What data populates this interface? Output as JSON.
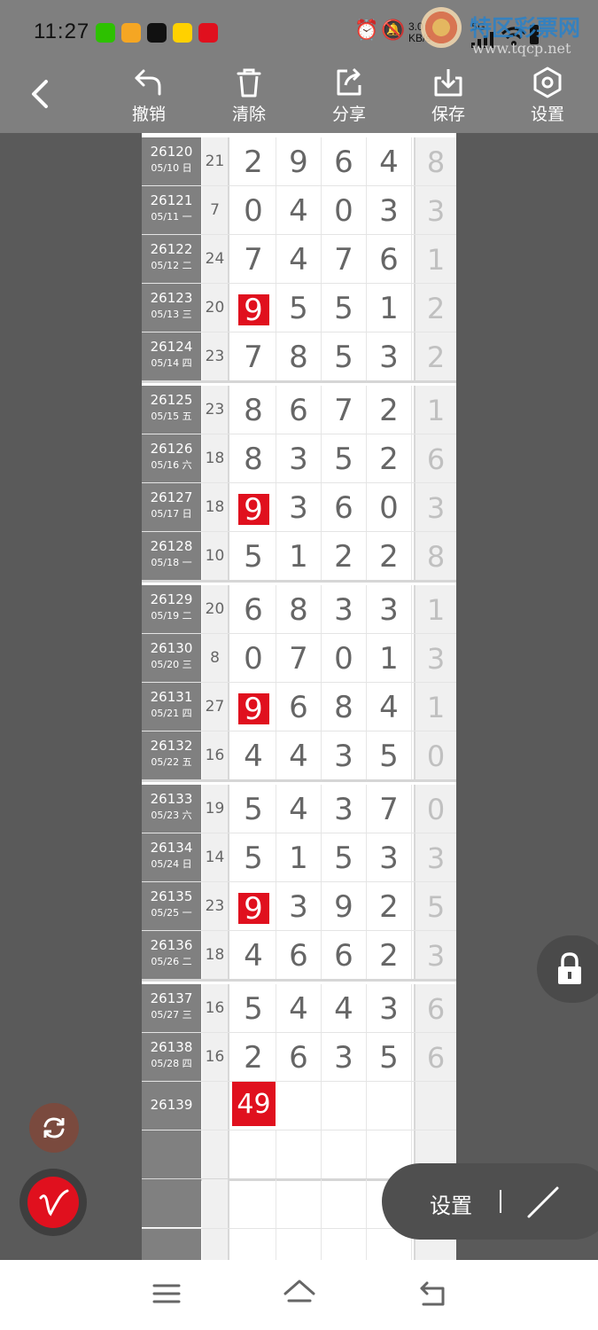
{
  "status_bar": {
    "time": "11:27",
    "app_icons": [
      {
        "icon": "wechat-icon",
        "color": "#2dc100"
      },
      {
        "icon": "app-icon",
        "color": "#f5a623"
      },
      {
        "icon": "tiktok-icon",
        "color": "#111111"
      },
      {
        "icon": "meituan-icon",
        "color": "#ffd100"
      },
      {
        "icon": "health-icon",
        "color": "#e0101e"
      }
    ],
    "net_speed_value": "3.0",
    "net_speed_unit": "KB/s",
    "signal_label": "5G",
    "watermark_title": "特区彩票网",
    "watermark_url": "www.tqcp.net"
  },
  "toolbar": {
    "undo": "撤销",
    "clear": "清除",
    "share": "分享",
    "save": "保存",
    "settings": "设置"
  },
  "rows": [
    {
      "issue": "26120",
      "date": "05/10 日",
      "sum": "21",
      "digits": [
        "2",
        "9",
        "6",
        "4"
      ],
      "extra": "8",
      "hit": -1
    },
    {
      "issue": "26121",
      "date": "05/11 一",
      "sum": "7",
      "digits": [
        "0",
        "4",
        "0",
        "3"
      ],
      "extra": "3",
      "hit": -1
    },
    {
      "issue": "26122",
      "date": "05/12 二",
      "sum": "24",
      "digits": [
        "7",
        "4",
        "7",
        "6"
      ],
      "extra": "1",
      "hit": -1
    },
    {
      "issue": "26123",
      "date": "05/13 三",
      "sum": "20",
      "digits": [
        "9",
        "5",
        "5",
        "1"
      ],
      "extra": "2",
      "hit": 0
    },
    {
      "issue": "26124",
      "date": "05/14 四",
      "sum": "23",
      "digits": [
        "7",
        "8",
        "5",
        "3"
      ],
      "extra": "2",
      "hit": -1
    },
    {
      "issue": "26125",
      "date": "05/15 五",
      "sum": "23",
      "digits": [
        "8",
        "6",
        "7",
        "2"
      ],
      "extra": "1",
      "hit": -1
    },
    {
      "issue": "26126",
      "date": "05/16 六",
      "sum": "18",
      "digits": [
        "8",
        "3",
        "5",
        "2"
      ],
      "extra": "6",
      "hit": -1
    },
    {
      "issue": "26127",
      "date": "05/17 日",
      "sum": "18",
      "digits": [
        "9",
        "3",
        "6",
        "0"
      ],
      "extra": "3",
      "hit": 0
    },
    {
      "issue": "26128",
      "date": "05/18 一",
      "sum": "10",
      "digits": [
        "5",
        "1",
        "2",
        "2"
      ],
      "extra": "8",
      "hit": -1
    },
    {
      "issue": "26129",
      "date": "05/19 二",
      "sum": "20",
      "digits": [
        "6",
        "8",
        "3",
        "3"
      ],
      "extra": "1",
      "hit": -1
    },
    {
      "issue": "26130",
      "date": "05/20 三",
      "sum": "8",
      "digits": [
        "0",
        "7",
        "0",
        "1"
      ],
      "extra": "3",
      "hit": -1
    },
    {
      "issue": "26131",
      "date": "05/21 四",
      "sum": "27",
      "digits": [
        "9",
        "6",
        "8",
        "4"
      ],
      "extra": "1",
      "hit": 0
    },
    {
      "issue": "26132",
      "date": "05/22 五",
      "sum": "16",
      "digits": [
        "4",
        "4",
        "3",
        "5"
      ],
      "extra": "0",
      "hit": -1
    },
    {
      "issue": "26133",
      "date": "05/23 六",
      "sum": "19",
      "digits": [
        "5",
        "4",
        "3",
        "7"
      ],
      "extra": "0",
      "hit": -1
    },
    {
      "issue": "26134",
      "date": "05/24 日",
      "sum": "14",
      "digits": [
        "5",
        "1",
        "5",
        "3"
      ],
      "extra": "3",
      "hit": -1
    },
    {
      "issue": "26135",
      "date": "05/25 一",
      "sum": "23",
      "digits": [
        "9",
        "3",
        "9",
        "2"
      ],
      "extra": "5",
      "hit": 0
    },
    {
      "issue": "26136",
      "date": "05/26 二",
      "sum": "18",
      "digits": [
        "4",
        "6",
        "6",
        "2"
      ],
      "extra": "3",
      "hit": -1
    },
    {
      "issue": "26137",
      "date": "05/27 三",
      "sum": "16",
      "digits": [
        "5",
        "4",
        "4",
        "3"
      ],
      "extra": "6",
      "hit": -1
    },
    {
      "issue": "26138",
      "date": "05/28 四",
      "sum": "16",
      "digits": [
        "2",
        "6",
        "3",
        "5"
      ],
      "extra": "6",
      "hit": -1
    }
  ],
  "pending_row": {
    "issue": "26139",
    "prediction": "49"
  },
  "pill": {
    "label": "设置",
    "separator": "|"
  },
  "colors": {
    "hit_red": "#e0101e",
    "header_gray": "#7f7f7f",
    "issue_gray": "#808080"
  }
}
